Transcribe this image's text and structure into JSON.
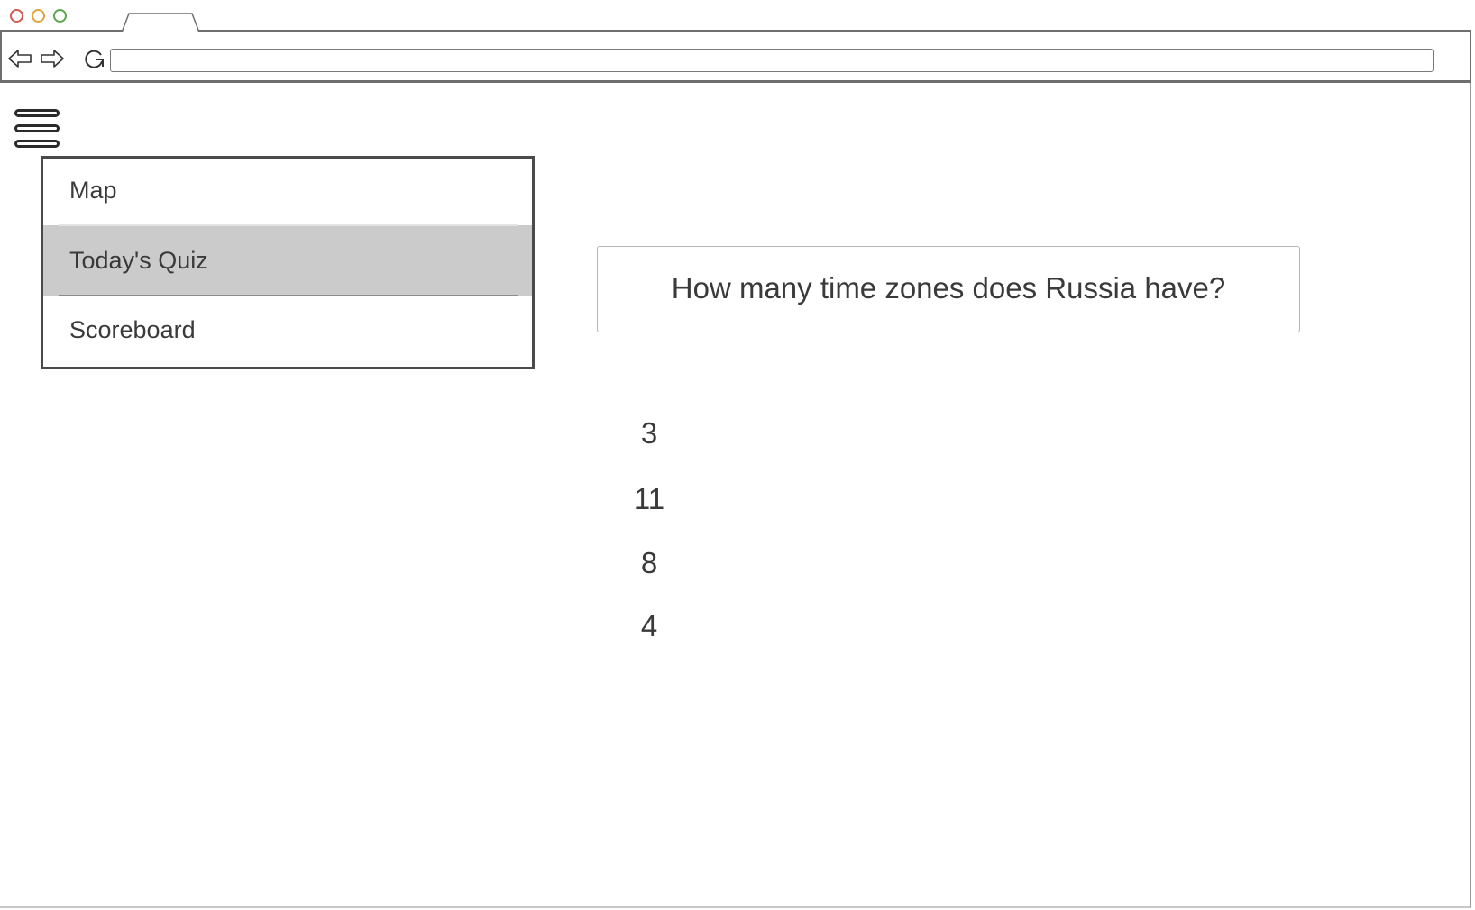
{
  "browser": {
    "url": "",
    "icons": {
      "close": "close-dot-icon",
      "minimize": "minimize-dot-icon",
      "maximize": "maximize-dot-icon",
      "back": "back-arrow-icon",
      "forward": "forward-arrow-icon",
      "reload": "reload-icon"
    },
    "colors": {
      "close": "#d35a4e",
      "minimize": "#e0a33b",
      "maximize": "#57a846"
    }
  },
  "menu": {
    "icon": "hamburger-menu-icon",
    "items": [
      {
        "label": "Map"
      },
      {
        "label": "Today's Quiz",
        "selected": true
      },
      {
        "label": "Scoreboard"
      }
    ],
    "selected_color": "#cbcbcb"
  },
  "quiz": {
    "question": "How many time zones does Russia have?",
    "answers": [
      "3",
      "11",
      "8",
      "4"
    ]
  }
}
